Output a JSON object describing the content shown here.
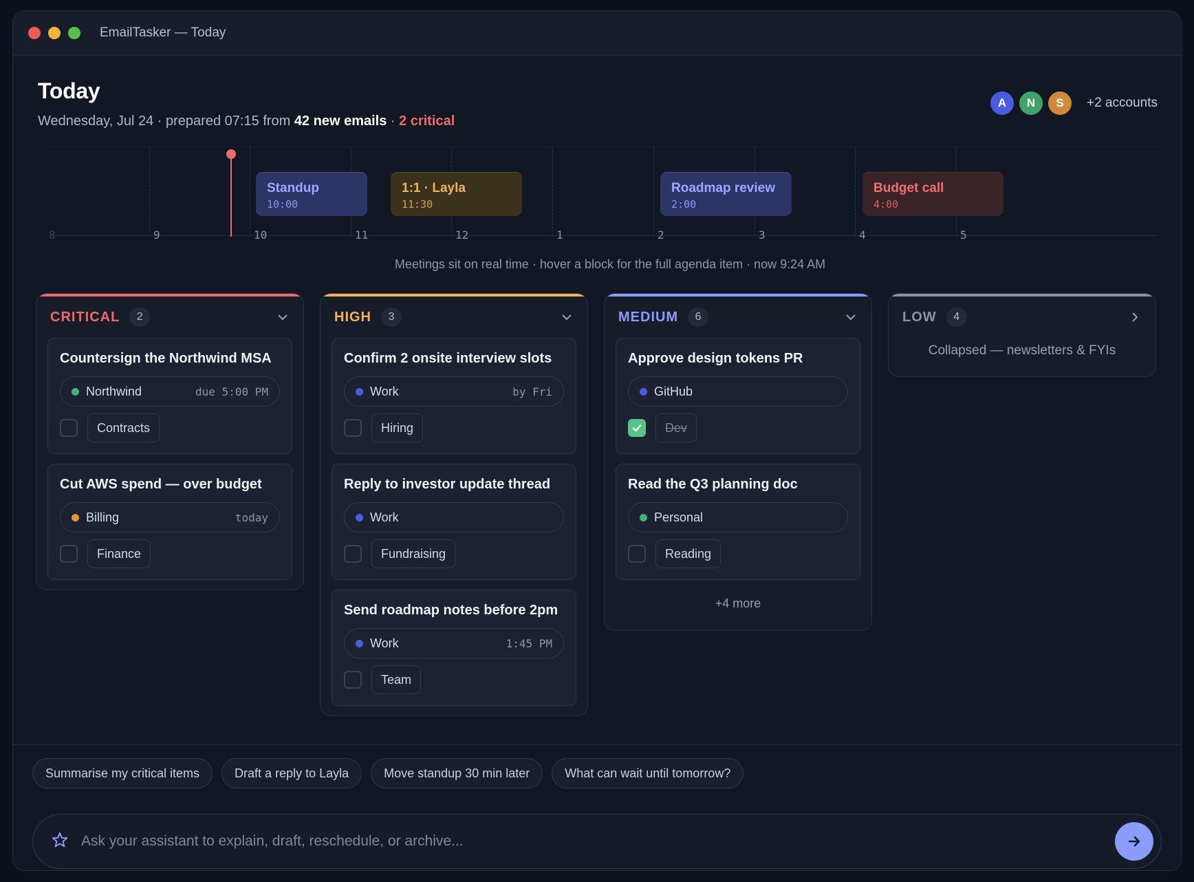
{
  "window": {
    "title": "EmailTasker — Today"
  },
  "header": {
    "title": "Today",
    "subtitle_prefix": "Wednesday, Jul 24 · prepared 07:15 from ",
    "subtitle_emails": "42 new emails",
    "subtitle_sep": " · ",
    "subtitle_critical": "2 critical",
    "accounts": [
      {
        "initial": "A",
        "color": "#4a5de0"
      },
      {
        "initial": "N",
        "color": "#3fa36a"
      },
      {
        "initial": "S",
        "color": "#d0893a"
      }
    ],
    "accounts_more": "+2 accounts"
  },
  "timeline": {
    "hours": [
      "8",
      "9",
      "10",
      "11",
      "12",
      "1",
      "2",
      "3",
      "4",
      "5"
    ],
    "now": "9:24 AM",
    "meetings": [
      {
        "name": "Standup",
        "time": "10:00",
        "bg": "#2b3566",
        "fg": "#9aa8ff"
      },
      {
        "name": "1:1 · Layla",
        "time": "11:30",
        "bg": "#3a321b",
        "fg": "#f2b35a"
      },
      {
        "name": "Roadmap review",
        "time": "2:00",
        "bg": "#2b3566",
        "fg": "#9aa8ff"
      },
      {
        "name": "Budget call",
        "time": "4:00",
        "bg": "#3a2327",
        "fg": "#f0706e"
      }
    ],
    "caption": "Meetings sit on real time · hover a block for the full agenda item · now 9:24 AM"
  },
  "columns": {
    "critical": {
      "name": "CRITICAL",
      "count": "2",
      "color": "#f06a6a",
      "cards": [
        {
          "title": "Countersign the Northwind MSA",
          "source": "Northwind",
          "source_color": "#3fb47a",
          "due": "due 5:00 PM",
          "tag": "Contracts"
        },
        {
          "title": "Cut AWS spend — over budget",
          "source": "Billing",
          "source_color": "#e3923e",
          "due": "today",
          "tag": "Finance"
        }
      ]
    },
    "high": {
      "name": "HIGH",
      "count": "3",
      "color": "#f2b35a",
      "cards": [
        {
          "title": "Confirm 2 onsite interview slots",
          "source": "Work",
          "source_color": "#4a5de0",
          "due": "by Fri",
          "tag": "Hiring"
        },
        {
          "title": "Reply to investor update thread",
          "source": "Work",
          "source_color": "#4a5de0",
          "due": "",
          "tag": "Fundraising"
        },
        {
          "title": "Send roadmap notes before 2pm",
          "source": "Work",
          "source_color": "#4a5de0",
          "due": "1:45 PM",
          "tag": "Team"
        }
      ]
    },
    "medium": {
      "name": "MEDIUM",
      "count": "6",
      "color": "#8b9cff",
      "cards": [
        {
          "title": "Approve design tokens PR",
          "source": "GitHub",
          "source_color": "#4a5de0",
          "due": "",
          "tag": "Dev",
          "done": true
        },
        {
          "title": "Read the Q3 planning doc",
          "source": "Personal",
          "source_color": "#3fb47a",
          "due": "",
          "tag": "Reading"
        }
      ],
      "more": "+4 more"
    },
    "low": {
      "name": "LOW",
      "count": "4",
      "color": "#8b92a2",
      "collapsed_text": "Collapsed — newsletters & FYIs"
    }
  },
  "assistant": {
    "suggestions": [
      "Summarise my critical items",
      "Draft a reply to Layla",
      "Move standup 30 min later",
      "What can wait until tomorrow?"
    ],
    "placeholder": "Ask your assistant to explain, draft, reschedule, or archive..."
  }
}
